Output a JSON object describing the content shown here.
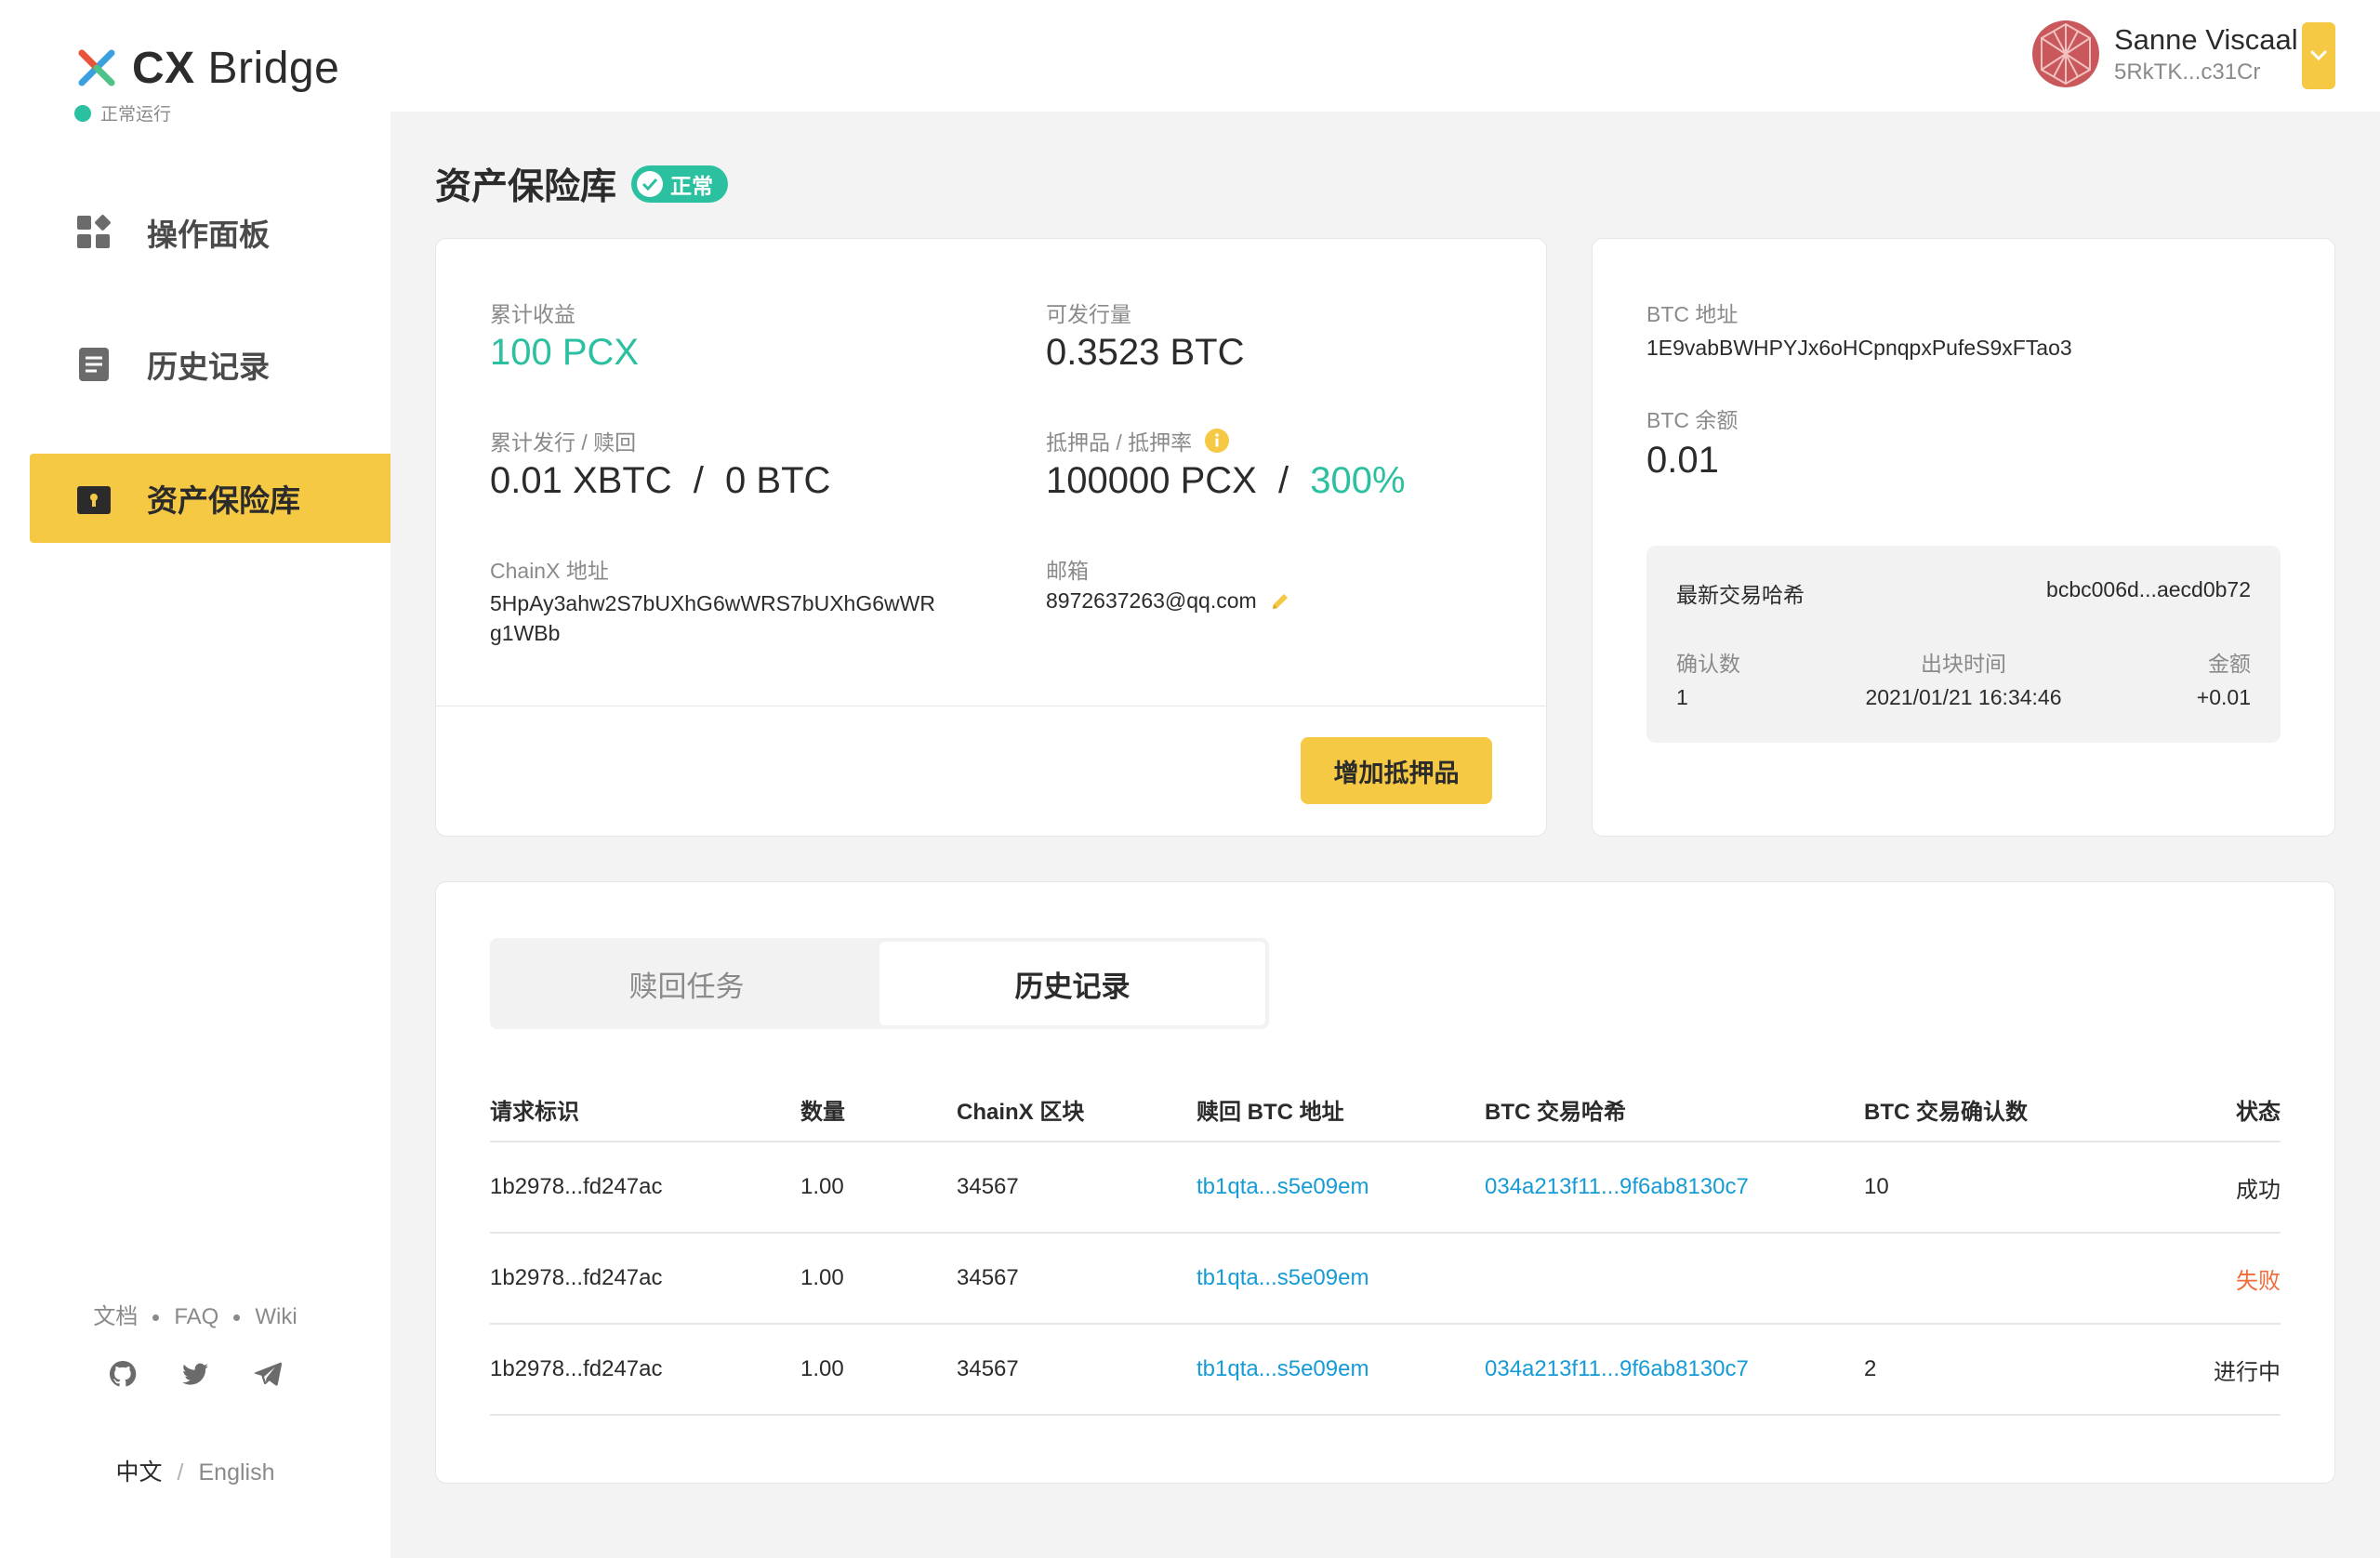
{
  "app": {
    "name_bold": "CX",
    "name_light": "Bridge",
    "status": "正常运行"
  },
  "nav": [
    {
      "label": "操作面板",
      "icon": "dashboard-icon"
    },
    {
      "label": "历史记录",
      "icon": "history-icon"
    },
    {
      "label": "资产保险库",
      "icon": "vault-icon"
    }
  ],
  "footer": {
    "links": [
      "文档",
      "FAQ",
      "Wiki"
    ],
    "lang_current": "中文",
    "lang_other": "English"
  },
  "user": {
    "name": "Sanne Viscaal",
    "address": "5RkTK...c31Cr"
  },
  "page": {
    "title": "资产保险库",
    "badge": "正常"
  },
  "vault": {
    "earnings_label": "累计收益",
    "earnings_value": "100 PCX",
    "issuable_label": "可发行量",
    "issuable_value": "0.3523 BTC",
    "issued_label": "累计发行 / 赎回",
    "issued_value": "0.01 XBTC",
    "sep": "/",
    "redeemed_value": "0 BTC",
    "collateral_label": "抵押品 / 抵押率",
    "collateral_value": "100000 PCX",
    "collateral_ratio": "300%",
    "chainx_label": "ChainX 地址",
    "chainx_line1": "5HpAy3ahw2S7bUXhG6wWRS7bUXhG6wWR",
    "chainx_line2": "g1WBb",
    "email_label": "邮箱",
    "email_value": "8972637263@qq.com",
    "add_collateral": "增加抵押品"
  },
  "btc": {
    "address_label": "BTC 地址",
    "address_value": "1E9vabBWHPYJx6oHCpnqpxPufeS9xFTao3",
    "balance_label": "BTC 余额",
    "balance_value": "0.01",
    "latest_tx_label": "最新交易哈希",
    "latest_tx_value": "bcbc006d...aecd0b72",
    "confirm_label": "确认数",
    "confirm_value": "1",
    "block_time_label": "出块时间",
    "block_time_value": "2021/01/21 16:34:46",
    "amount_label": "金额",
    "amount_value": "+0.01"
  },
  "tabs": {
    "redeem": "赎回任务",
    "history": "历史记录"
  },
  "table": {
    "headers": [
      "请求标识",
      "数量",
      "ChainX 区块",
      "赎回 BTC 地址",
      "BTC 交易哈希",
      "BTC 交易确认数",
      "状态"
    ],
    "rows": [
      {
        "id": "1b2978...fd247ac",
        "amount": "1.00",
        "block": "34567",
        "addr": "tb1qta...s5e09em",
        "hash": "034a213f11...9f6ab8130c7",
        "confirms": "10",
        "status": "成功"
      },
      {
        "id": "1b2978...fd247ac",
        "amount": "1.00",
        "block": "34567",
        "addr": "tb1qta...s5e09em",
        "hash": "",
        "confirms": "",
        "status": "失败"
      },
      {
        "id": "1b2978...fd247ac",
        "amount": "1.00",
        "block": "34567",
        "addr": "tb1qta...s5e09em",
        "hash": "034a213f11...9f6ab8130c7",
        "confirms": "2",
        "status": "进行中"
      }
    ]
  },
  "colors": {
    "accent": "#f6c944",
    "success": "#2bc0a0",
    "link": "#169bd5",
    "fail": "#f06a3a"
  }
}
